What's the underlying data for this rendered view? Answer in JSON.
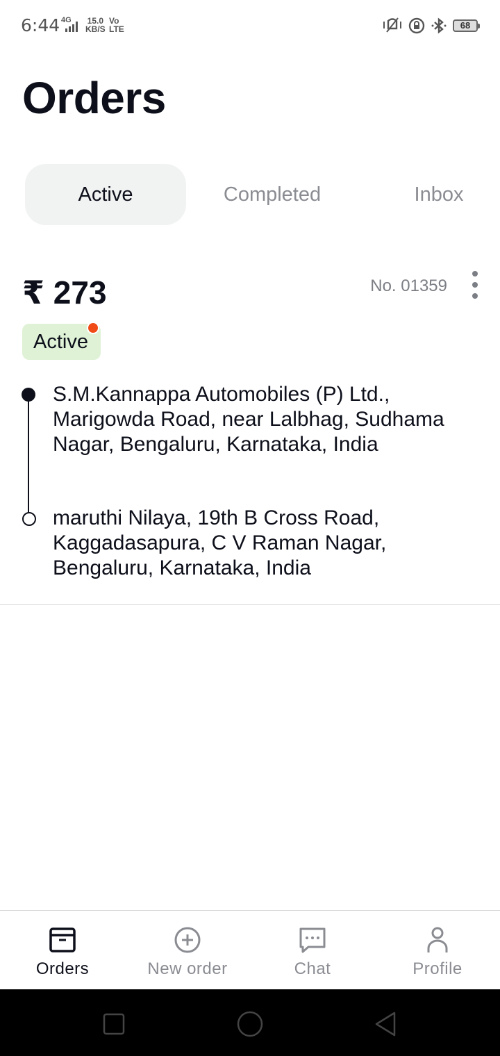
{
  "status_bar": {
    "time": "6:44",
    "network": "4G",
    "speed_value": "15.0",
    "speed_unit": "KB/S",
    "volte_top": "Vo",
    "volte_bottom": "LTE",
    "battery": "68"
  },
  "page": {
    "title": "Orders"
  },
  "tabs": [
    {
      "label": "Active",
      "selected": true
    },
    {
      "label": "Completed",
      "selected": false
    },
    {
      "label": "Inbox",
      "selected": false
    }
  ],
  "order": {
    "price": "₹ 273",
    "number": "No. 01359",
    "status": "Active",
    "pickup_address": "S.M.Kannappa Automobiles (P) Ltd., Marigowda Road, near Lalbhag, Sudhama Nagar, Bengaluru, Karnataka, India",
    "drop_address": "maruthi Nilaya, 19th B Cross Road, Kaggadasapura, C V Raman Nagar, Bengaluru, Karnataka, India"
  },
  "bottom_nav": [
    {
      "label": "Orders",
      "icon": "box-icon",
      "active": true
    },
    {
      "label": "New order",
      "icon": "plus-circle-icon",
      "active": false
    },
    {
      "label": "Chat",
      "icon": "chat-icon",
      "active": false
    },
    {
      "label": "Profile",
      "icon": "person-icon",
      "active": false
    }
  ],
  "colors": {
    "accent_dark": "#0d0f1a",
    "active_badge_bg": "#dff2d6",
    "notification_dot": "#f04a17",
    "inactive_text": "#8a8c92"
  }
}
